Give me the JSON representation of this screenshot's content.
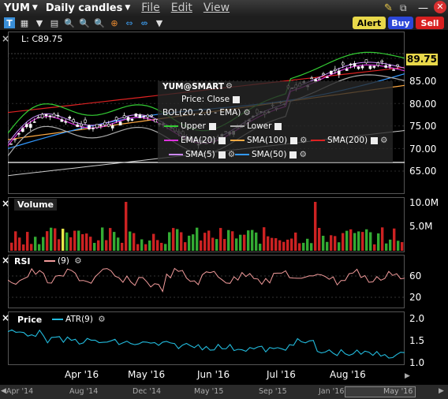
{
  "menubar": {
    "symbol": "YUM",
    "timeframe": "Daily candles",
    "menus": [
      "File",
      "Edit",
      "View"
    ]
  },
  "toolbar": {
    "alert": "Alert",
    "buy": "Buy",
    "sell": "Sell"
  },
  "price_panel": {
    "last_label": "L: C89.75",
    "current_price": "89.75",
    "y_ticks": [
      "85.00",
      "80.00",
      "75.00",
      "70.00",
      "65.00"
    ],
    "legend": {
      "title": "YUM@SMART",
      "price": "Price: Close",
      "bol": "BOL(20, 2.0 - EMA)",
      "upper": "Upper",
      "lower": "Lower",
      "ema20": "EMA(20)",
      "sma100": "SMA(100)",
      "sma200": "SMA(200)",
      "sma5": "SMA(5)",
      "sma50": "SMA(50)"
    },
    "colors": {
      "upper": "#33cc33",
      "lower": "#aaaaaa",
      "ema20": "#dd33dd",
      "sma100": "#ffaa44",
      "sma200": "#dd2222",
      "sma5": "#cc88ff",
      "sma50": "#3399ff",
      "price_tag": "#e8d84a"
    }
  },
  "volume_panel": {
    "title": "Volume",
    "y_ticks": [
      "10.0M",
      "5.0M"
    ]
  },
  "rsi_panel": {
    "title": "RSI",
    "period": "(9)",
    "y_ticks": [
      "60",
      "20"
    ]
  },
  "atr_panel": {
    "title": "Price",
    "atr": "ATR(9)",
    "y_ticks": [
      "2.0",
      "1.5",
      "1.0"
    ],
    "x_ticks": [
      "Apr '16",
      "May '16",
      "Jun '16",
      "Jul '16",
      "Aug '16"
    ]
  },
  "scrollbar": {
    "labels": [
      "Apr '14",
      "Aug '14",
      "Dec '14",
      "May '15",
      "Sep '15",
      "Jan '16",
      "May '16"
    ]
  }
}
